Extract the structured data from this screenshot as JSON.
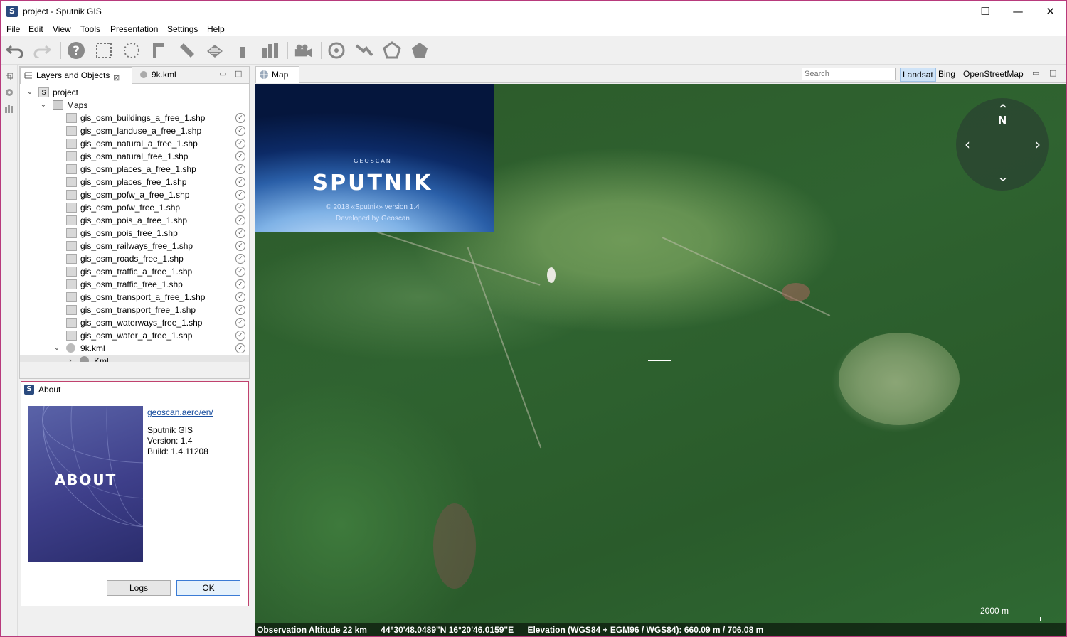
{
  "window": {
    "title": "project - Sputnik GIS",
    "app_icon_letter": "S",
    "minimize": "—",
    "maximize": "☐",
    "close": "✕"
  },
  "menu": [
    "File",
    "Edit",
    "View",
    "Tools",
    "Presentation",
    "Settings",
    "Help"
  ],
  "toolbar": {
    "icons": [
      "undo-icon",
      "redo-icon",
      "help-icon",
      "rect-select-icon",
      "lasso-select-icon",
      "ruler-icon",
      "measure-line-icon",
      "area-icon",
      "height-icon",
      "profile-icon",
      "camera-icon",
      "target-icon",
      "path-icon",
      "polygon-icon",
      "filled-polygon-icon"
    ]
  },
  "layers_panel": {
    "tab_active": "Layers and Objects",
    "tab_second": "9k.kml",
    "tree": {
      "root": "project",
      "maps_folder": "Maps",
      "layers": [
        "gis_osm_buildings_a_free_1.shp",
        "gis_osm_landuse_a_free_1.shp",
        "gis_osm_natural_a_free_1.shp",
        "gis_osm_natural_free_1.shp",
        "gis_osm_places_a_free_1.shp",
        "gis_osm_places_free_1.shp",
        "gis_osm_pofw_a_free_1.shp",
        "gis_osm_pofw_free_1.shp",
        "gis_osm_pois_a_free_1.shp",
        "gis_osm_pois_free_1.shp",
        "gis_osm_railways_free_1.shp",
        "gis_osm_roads_free_1.shp",
        "gis_osm_traffic_a_free_1.shp",
        "gis_osm_traffic_free_1.shp",
        "gis_osm_transport_a_free_1.shp",
        "gis_osm_transport_free_1.shp",
        "gis_osm_waterways_free_1.shp",
        "gis_osm_water_a_free_1.shp"
      ],
      "kml_node": "9k.kml",
      "kml_child": "Kml"
    }
  },
  "about": {
    "title": "About",
    "image_text": "ABOUT",
    "link": "geoscan.aero/en/",
    "product": "Sputnik GIS",
    "version": "Version: 1.4",
    "build": "Build: 1.4.11208",
    "logs_button": "Logs",
    "ok_button": "OK"
  },
  "map": {
    "tab": "Map",
    "search_placeholder": "Search",
    "sources": [
      "Landsat",
      "Bing",
      "OpenStreetMap"
    ],
    "active_source": "Landsat",
    "splash": {
      "brand": "GEOSCAN",
      "title": "SPUTNIK",
      "copyright": "© 2018 «Sputnik» version 1.4",
      "developer": "Developed by Geoscan"
    },
    "compass_north": "N",
    "scale_label": "2000 m",
    "status": {
      "altitude": "Observation Altitude 22 km",
      "coords": "44°30'48.0489\"N 16°20'46.0159\"E",
      "elevation": "Elevation (WGS84 + EGM96 / WGS84): 660.09 m / 706.08 m"
    }
  }
}
